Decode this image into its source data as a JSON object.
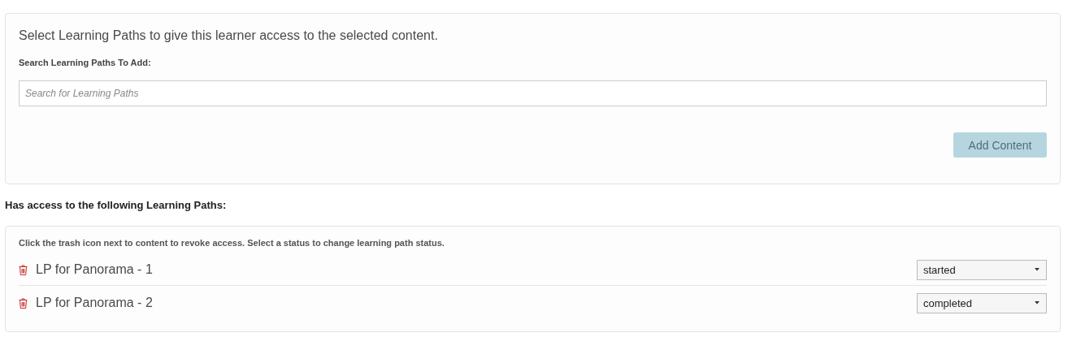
{
  "intro": "Select Learning Paths to give this learner access to the selected content.",
  "search": {
    "label": "Search Learning Paths To Add:",
    "placeholder": "Search for Learning Paths"
  },
  "add_button": {
    "label": "Add Content",
    "disabled": true
  },
  "access_heading": "Has access to the following Learning Paths:",
  "access_hint": "Click the trash icon next to content to revoke access. Select a status to change learning path status.",
  "paths": [
    {
      "name": "LP for Panorama - 1",
      "status": "started"
    },
    {
      "name": "LP for Panorama - 2",
      "status": "completed"
    }
  ]
}
